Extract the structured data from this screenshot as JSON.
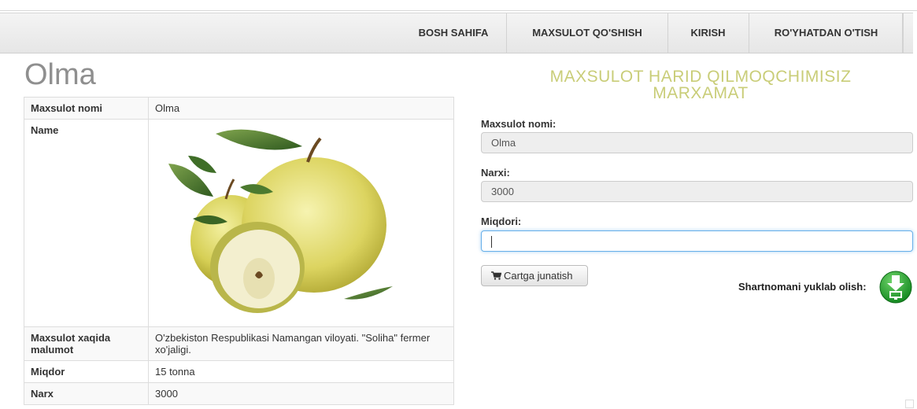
{
  "nav": {
    "items": [
      {
        "label": "BOSH SAHIFA"
      },
      {
        "label": "MAXSULOT QO'SHISH"
      },
      {
        "label": "KIRISH"
      },
      {
        "label": "RO'YHATDAN O'TISH"
      }
    ]
  },
  "product": {
    "title": "Olma",
    "rows": [
      {
        "key": "Maxsulot nomi",
        "value": "Olma"
      },
      {
        "key": "Name",
        "value": ""
      },
      {
        "key": "Maxsulot xaqida malumot",
        "value": "O'zbekiston Respublikasi Namangan viloyati. \"Soliha\" fermer xo'jaligi."
      },
      {
        "key": "Miqdor",
        "value": "15 tonna"
      },
      {
        "key": "Narx",
        "value": "3000"
      }
    ]
  },
  "order": {
    "heading": "MAXSULOT HARID QILMOQCHIMISIZ MARXAMAT",
    "name_label": "Maxsulot nomi:",
    "name_value": "Olma",
    "price_label": "Narxi:",
    "price_value": "3000",
    "qty_label": "Miqdori:",
    "qty_value": "",
    "cart_button": "Cartga junatish",
    "download_label": "Shartnomani yuklab olish:"
  },
  "icons": {
    "cart": "shopping-cart-icon",
    "download": "download-icon",
    "product_image": "apple-image"
  },
  "colors": {
    "heading": "#c9cd78",
    "title": "#8f8f8f",
    "download_green": "#1fa12b",
    "focus_border": "#66afe9"
  }
}
